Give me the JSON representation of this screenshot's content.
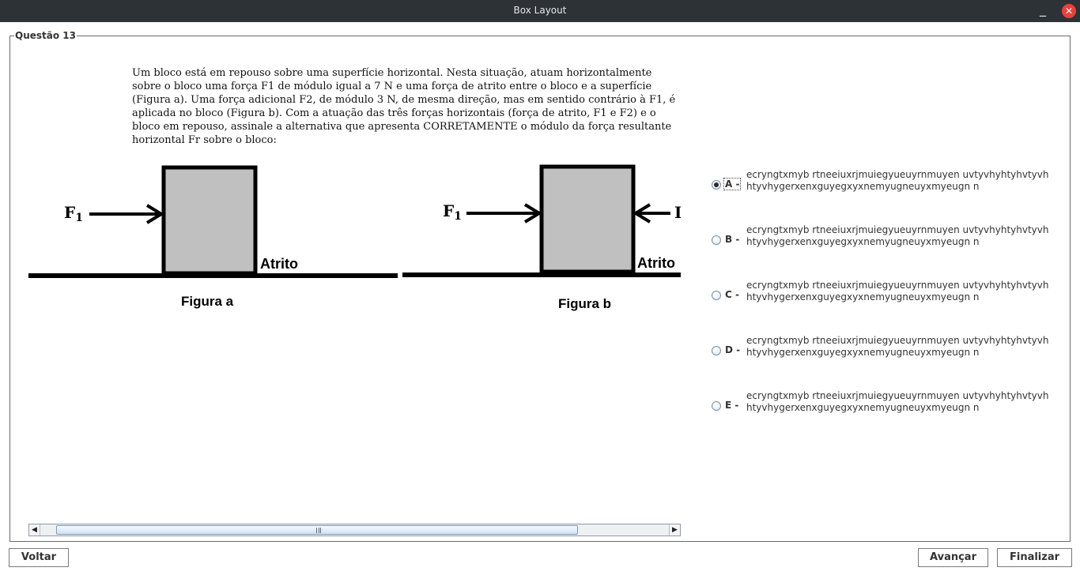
{
  "window": {
    "title": "Box Layout",
    "minimize_glyph": "_",
    "close_glyph": "✕"
  },
  "group": {
    "legend": "Questão 13"
  },
  "question": {
    "text": "Um bloco está em repouso sobre uma superfície horizontal. Nesta situação, atuam horizontalmente sobre o bloco uma força F1 de módulo igual a 7 N e uma força de atrito entre o bloco e a superfície (Figura a). Uma força adicional F2, de módulo 3 N, de mesma direção, mas em sentido contrário à F1, é aplicada no bloco (Figura b). Com a atuação das três forças horizontais (força de atrito, F1 e F2) e o bloco em repouso, assinale a alternativa que apresenta CORRETAMENTE o módulo da força resultante horizontal Fr sobre o bloco:"
  },
  "figures": {
    "a": {
      "force_label": "F",
      "force_subscript": "1",
      "friction_label": "Atrito",
      "caption": "Figura a"
    },
    "b": {
      "force_label": "F",
      "force_subscript": "1",
      "clipped_label": "I",
      "friction_label": "Atrito",
      "caption": "Figura b"
    }
  },
  "options": [
    {
      "letter": "A -",
      "text": "ecryngtxmyb rtneeiuxrjmuiegyueuyrnmuyen uvtyvhyhtyhvtyvhhtyvhygerxenxguyegxyxnemyugneuyxmyeugn n",
      "selected": true
    },
    {
      "letter": "B -",
      "text": "ecryngtxmyb rtneeiuxrjmuiegyueuyrnmuyen uvtyvhyhtyhvtyvhhtyvhygerxenxguyegxyxnemyugneuyxmyeugn n",
      "selected": false
    },
    {
      "letter": "C -",
      "text": "ecryngtxmyb rtneeiuxrjmuiegyueuyrnmuyen uvtyvhyhtyhvtyvhhtyvhygerxenxguyegxyxnemyugneuyxmyeugn n",
      "selected": false
    },
    {
      "letter": "D -",
      "text": "ecryngtxmyb rtneeiuxrjmuiegyueuyrnmuyen uvtyvhyhtyhvtyvhhtyvhygerxenxguyegxyxnemyugneuyxmyeugn n",
      "selected": false
    },
    {
      "letter": "E -",
      "text": "ecryngtxmyb rtneeiuxrjmuiegyueuyrnmuyen uvtyvhyhtyhvtyvhhtyvhygerxenxguyegxyxnemyugneuyxmyeugn n",
      "selected": false
    }
  ],
  "buttons": {
    "back": "Voltar",
    "next": "Avançar",
    "finish": "Finalizar"
  },
  "icons": {
    "scroll_left": "left-arrow-icon",
    "scroll_right": "right-arrow-icon"
  }
}
